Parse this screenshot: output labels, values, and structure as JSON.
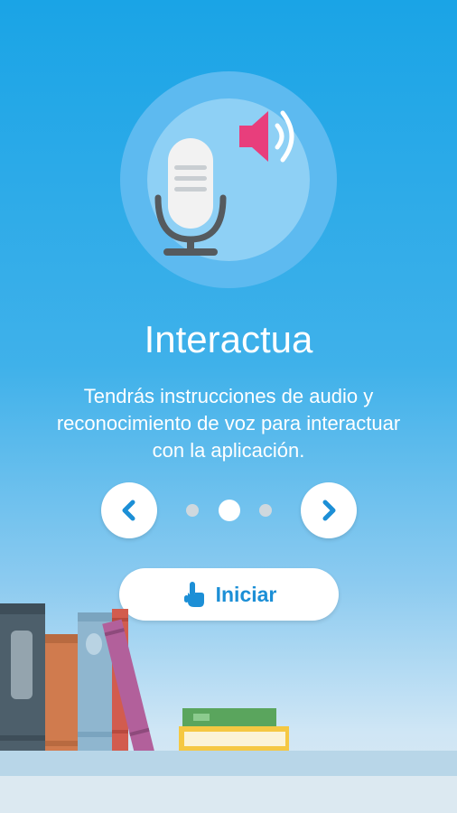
{
  "slide": {
    "title": "Interactua",
    "description": "Tendrás instrucciones de audio y reconocimiento de voz para interactuar con la aplicación."
  },
  "icons": {
    "hero": "microphone-icon",
    "sound": "speaker-icon",
    "prev": "chevron-left-icon",
    "next": "chevron-right-icon",
    "start": "pointing-hand-icon"
  },
  "pager": {
    "total": 3,
    "current": 2
  },
  "start_button": {
    "label": "Iniciar"
  },
  "colors": {
    "accent": "#1c8fd6",
    "speaker": "#e83e7c",
    "mic_body": "#f2f2f2",
    "mic_stand": "#555a5e",
    "dot_active": "#ffffff",
    "dot_inactive": "#cfd8de"
  }
}
